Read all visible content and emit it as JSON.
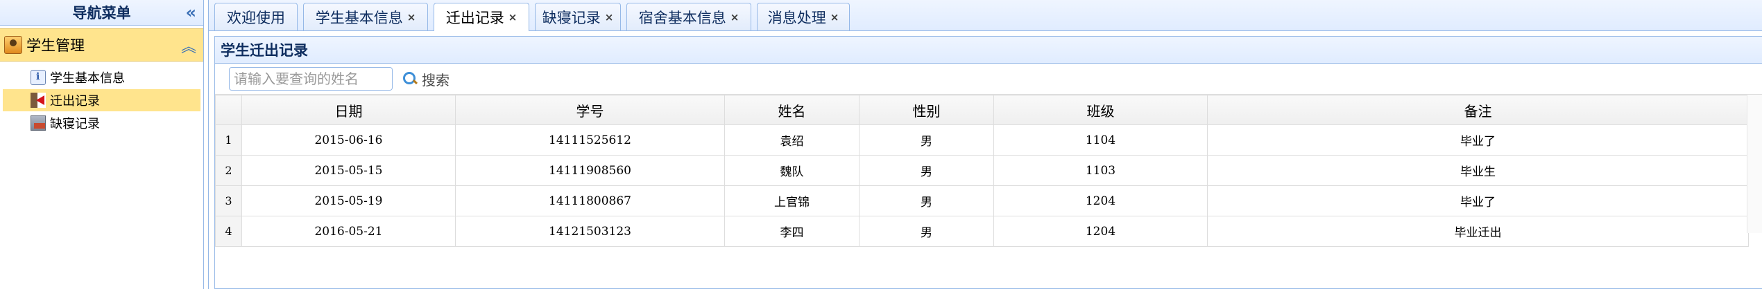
{
  "nav": {
    "title": "导航菜单",
    "collapse_icon": "«",
    "panel_title": "学生管理",
    "panel_toggle_icon": "︽",
    "items": [
      {
        "label": "学生基本信息",
        "icon": "info-icon",
        "selected": false
      },
      {
        "label": "迁出记录",
        "icon": "move-out-icon",
        "selected": true
      },
      {
        "label": "缺寝记录",
        "icon": "absence-icon",
        "selected": false
      }
    ]
  },
  "tabs": [
    {
      "label": "欢迎使用",
      "closable": false,
      "active": false
    },
    {
      "label": "学生基本信息",
      "closable": true,
      "active": false
    },
    {
      "label": "迁出记录",
      "closable": true,
      "active": true
    },
    {
      "label": "缺寝记录",
      "closable": true,
      "active": false
    },
    {
      "label": "宿舍基本信息",
      "closable": true,
      "active": false
    },
    {
      "label": "消息处理",
      "closable": true,
      "active": false
    }
  ],
  "tab_close_glyph": "×",
  "panel": {
    "title": "学生迁出记录",
    "search": {
      "placeholder": "请输入要查询的姓名",
      "value": "",
      "button_label": "搜索"
    }
  },
  "grid": {
    "columns": [
      "日期",
      "学号",
      "姓名",
      "性别",
      "班级",
      "备注"
    ],
    "rows": [
      {
        "num": "1",
        "cells": [
          "2015-06-16",
          "14111525612",
          "袁绍",
          "男",
          "1104",
          "毕业了"
        ]
      },
      {
        "num": "2",
        "cells": [
          "2015-05-15",
          "14111908560",
          "魏队",
          "男",
          "1103",
          "毕业生"
        ]
      },
      {
        "num": "3",
        "cells": [
          "2015-05-19",
          "14111800867",
          "上官锦",
          "男",
          "1204",
          "毕业了"
        ]
      },
      {
        "num": "4",
        "cells": [
          "2016-05-21",
          "14121503123",
          "李四",
          "男",
          "1204",
          "毕业迁出"
        ]
      }
    ]
  }
}
